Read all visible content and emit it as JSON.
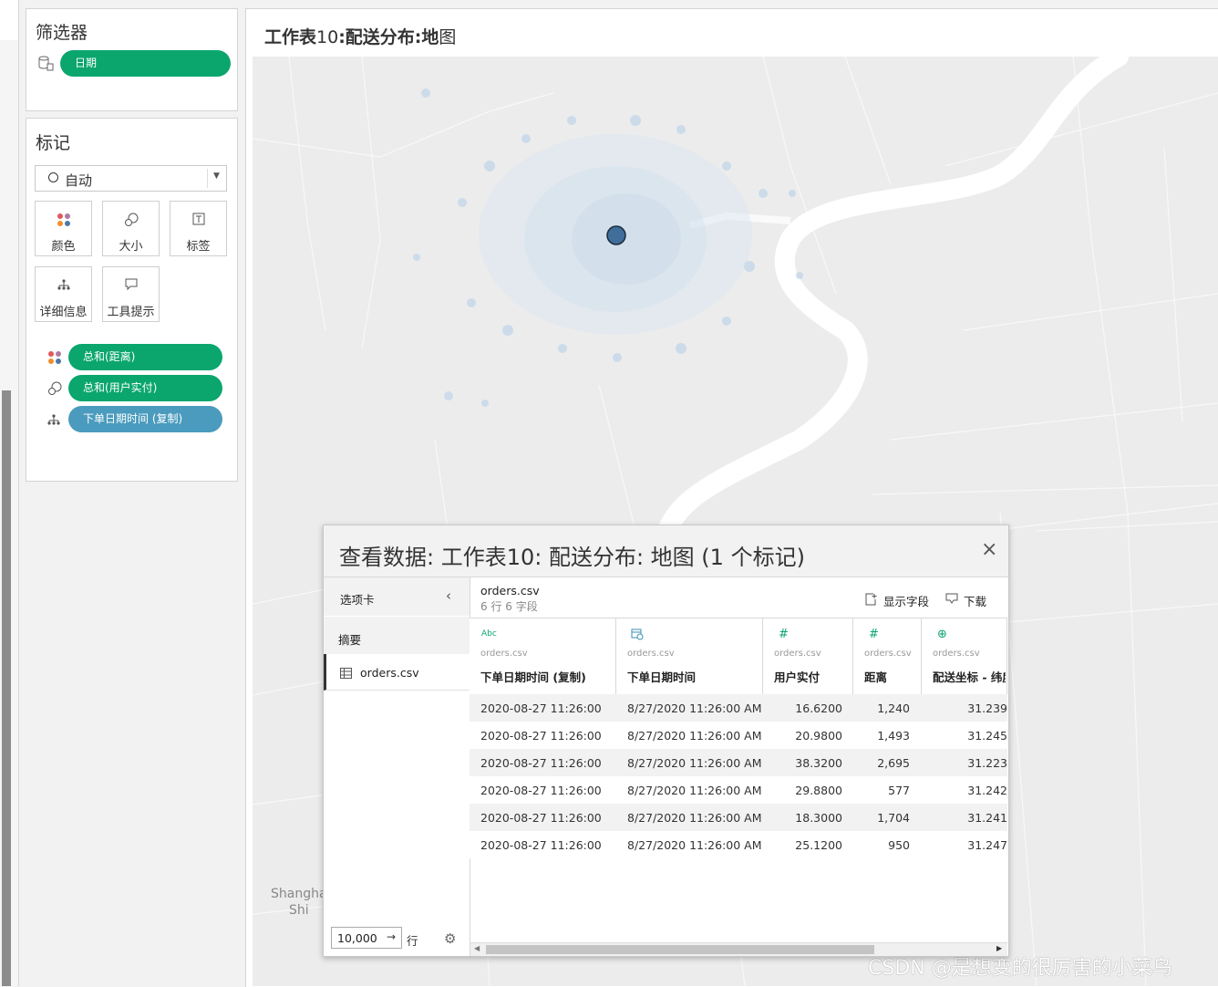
{
  "filters": {
    "title": "筛选器",
    "pill": "日期"
  },
  "marks": {
    "title": "标记",
    "type_select": "自动",
    "cards": [
      {
        "label": "颜色",
        "icon": "color-icon"
      },
      {
        "label": "大小",
        "icon": "size-icon"
      },
      {
        "label": "标签",
        "icon": "label-icon"
      },
      {
        "label": "详细信息",
        "icon": "detail-icon"
      },
      {
        "label": "工具提示",
        "icon": "tooltip-icon"
      }
    ],
    "pills": [
      {
        "label": "总和(距离)",
        "icon": "color-icon",
        "color": "#0aa66e"
      },
      {
        "label": "总和(用户实付)",
        "icon": "size-icon",
        "color": "#0aa66e"
      },
      {
        "label": "下单日期时间 (复制)",
        "icon": "detail-icon",
        "color": "#4a9bbd"
      }
    ]
  },
  "sheet": {
    "title_prefix": "工作表",
    "title_number": "10",
    "title_main": ":配送分布:地",
    "title_suffix": "图"
  },
  "map": {
    "labels": [
      "Shangha",
      "Shi"
    ],
    "watermark": "CSDN @是想变的很厉害的小菜鸟",
    "selected_point_color": "#3f6e9a"
  },
  "dialog": {
    "title": "查看数据:  工作表10:  配送分布:  地图 (1 个标记)",
    "sidebar": {
      "tab_header": "选项卡",
      "summary": "摘要",
      "source_item": "orders.csv",
      "row_limit": "10,000",
      "row_unit": "行"
    },
    "source_name": "orders.csv",
    "source_info": "6 行 6 字段",
    "show_fields": "显示字段",
    "download": "下载",
    "columns": [
      {
        "source": "orders.csv",
        "name": "下单日期时间 (复制)",
        "type_icon": "string-abc-icon",
        "type_text": "Abc"
      },
      {
        "source": "orders.csv",
        "name": "下单日期时间",
        "type_icon": "datetime-icon",
        "type_text": "⌚"
      },
      {
        "source": "orders.csv",
        "name": "用户实付",
        "type_icon": "number-icon",
        "type_text": "#"
      },
      {
        "source": "orders.csv",
        "name": "距离",
        "type_icon": "number-icon",
        "type_text": "#"
      },
      {
        "source": "orders.csv",
        "name": "配送坐标 - 纬度",
        "type_icon": "geo-icon",
        "type_text": "⊕"
      }
    ],
    "rows": [
      [
        "2020-08-27 11:26:00",
        "8/27/2020 11:26:00 AM",
        "16.6200",
        "1,240",
        "31.239"
      ],
      [
        "2020-08-27 11:26:00",
        "8/27/2020 11:26:00 AM",
        "20.9800",
        "1,493",
        "31.245"
      ],
      [
        "2020-08-27 11:26:00",
        "8/27/2020 11:26:00 AM",
        "38.3200",
        "2,695",
        "31.223"
      ],
      [
        "2020-08-27 11:26:00",
        "8/27/2020 11:26:00 AM",
        "29.8800",
        "577",
        "31.242"
      ],
      [
        "2020-08-27 11:26:00",
        "8/27/2020 11:26:00 AM",
        "18.3000",
        "1,704",
        "31.241"
      ],
      [
        "2020-08-27 11:26:00",
        "8/27/2020 11:26:00 AM",
        "25.1200",
        "950",
        "31.247"
      ]
    ]
  }
}
